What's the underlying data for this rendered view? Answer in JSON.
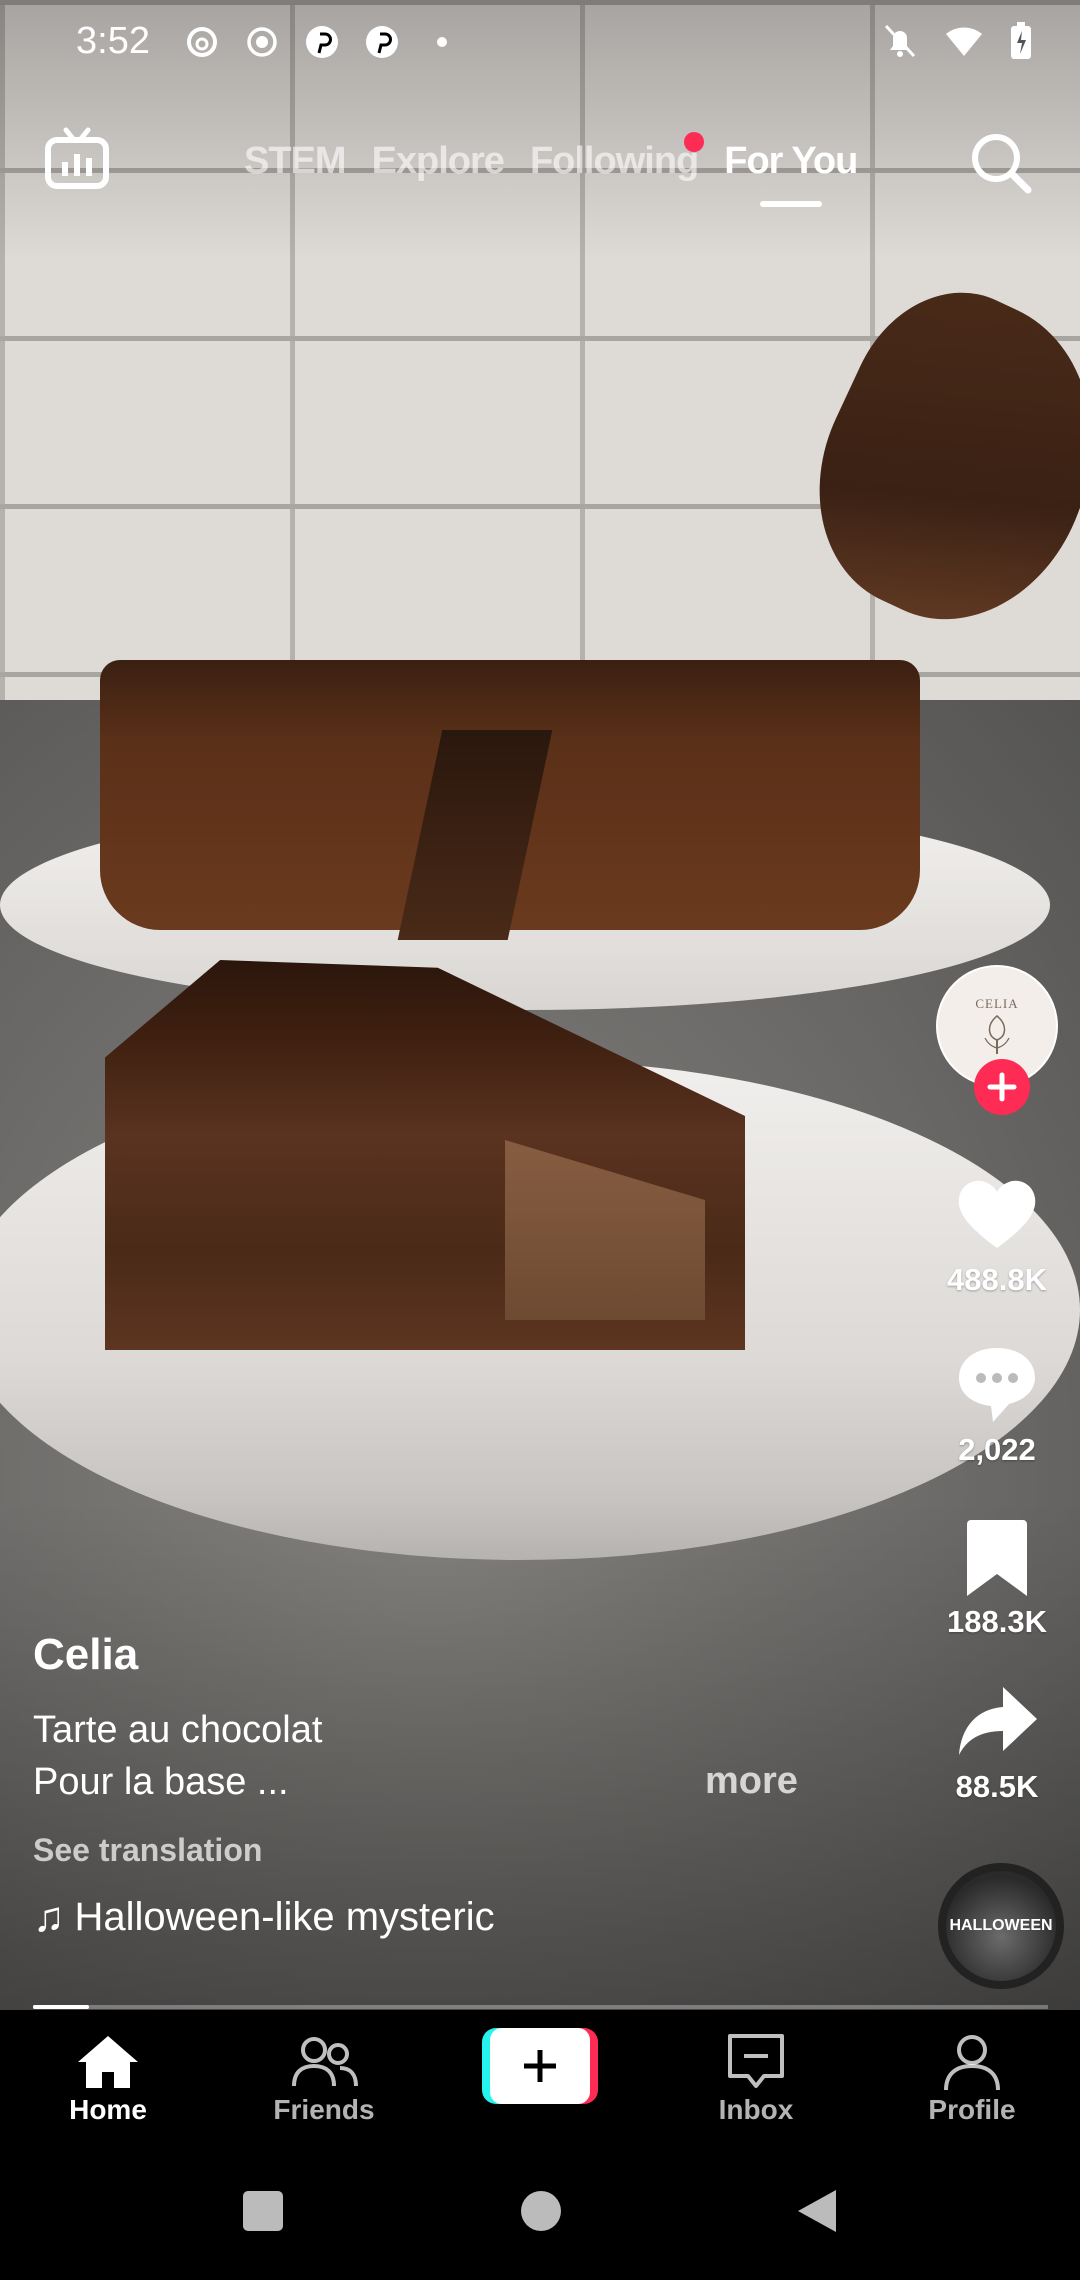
{
  "status_bar": {
    "time": "3:52",
    "left_icons": [
      "threads-icon",
      "record-icon",
      "pinterest-icon",
      "pinterest-icon",
      "dot-icon"
    ],
    "right_icons": [
      "mute-icon",
      "wifi-icon",
      "battery-charging-icon"
    ]
  },
  "top_nav": {
    "live_icon": "tv-icon",
    "tabs": [
      {
        "label": "STEM",
        "active": false
      },
      {
        "label": "Explore",
        "active": false
      },
      {
        "label": "Following",
        "active": false,
        "badge": true
      },
      {
        "label": "For You",
        "active": true
      }
    ],
    "search_icon": "search-icon"
  },
  "creator": {
    "avatar_text": "CELIA",
    "follow_icon": "plus-icon"
  },
  "actions": {
    "likes": "488.8K",
    "comments": "2,022",
    "saves": "188.3K",
    "shares": "88.5K"
  },
  "music_disc_text": "HALLOWEEN",
  "post": {
    "author": "Celia",
    "line1": "Tarte au chocolat",
    "line2": "Pour la base ...",
    "more": "more",
    "see_translation": "See translation",
    "sound": "Halloween-like mysteric"
  },
  "progress": 0.055,
  "bottom_nav": {
    "home": "Home",
    "friends": "Friends",
    "inbox": "Inbox",
    "profile": "Profile"
  },
  "colors": {
    "accent": "#fe2c55",
    "cyan": "#25f4ee"
  }
}
